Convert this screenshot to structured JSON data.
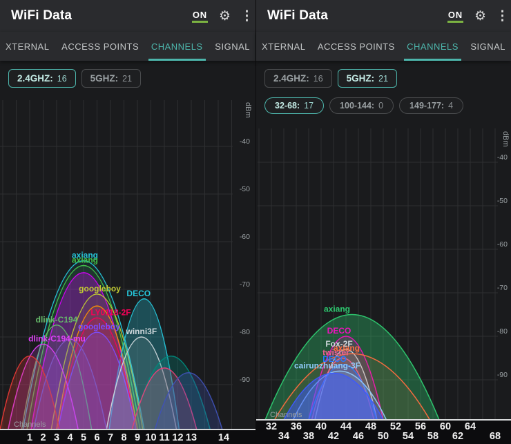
{
  "app": {
    "title": "WiFi Data",
    "on_toggle": "ON",
    "accent_color": "#4db6ac",
    "on_underline_color": "#7cb342",
    "icons": [
      "gear-icon",
      "more-options-icon"
    ]
  },
  "tabs": [
    {
      "label": "XTERNAL",
      "selected": false
    },
    {
      "label": "ACCESS POINTS",
      "selected": false
    },
    {
      "label": "CHANNELS",
      "selected": true
    },
    {
      "label": "SIGNAL",
      "selected": false
    }
  ],
  "panels": [
    {
      "name": "2.4ghz",
      "band_chips": [
        {
          "label": "2.4GHZ:",
          "count": "16",
          "selected": true
        },
        {
          "label": "5GHZ:",
          "count": "21",
          "selected": false
        }
      ],
      "range_chips": [],
      "chart": {
        "y_axis": {
          "unit": "dBm",
          "ticks": [
            "-40",
            "-50",
            "-60",
            "-70",
            "-80",
            "-90"
          ]
        },
        "x_axis": {
          "label": "Channels",
          "rows": [
            [
              "1",
              "2",
              "3",
              "4",
              "5",
              "6",
              "7",
              "8",
              "9",
              "10",
              "11",
              "12",
              "13",
              "14"
            ]
          ]
        },
        "networks": [
          {
            "ssid": "axiang",
            "channel": 5,
            "dbm": -64,
            "width_channels": 4.5,
            "color": "#26c6da",
            "fill_opacity": 0.08,
            "label_dx": 2
          },
          {
            "ssid": "axiang",
            "channel": 5,
            "dbm": -65,
            "width_channels": 4.2,
            "color": "#43c54b",
            "fill_opacity": 0.1,
            "label_dx": 2
          },
          {
            "ssid": "",
            "channel": 5,
            "dbm": -66.5,
            "width_channels": 3.9,
            "color": "#d500f9",
            "fill_opacity": 0.3,
            "label_dx": 0
          },
          {
            "ssid": "googleboy",
            "channel": 6,
            "dbm": -71,
            "width_channels": 3.4,
            "color": "#c0ca33",
            "fill_opacity": 0.08,
            "label_dx": 4
          },
          {
            "ssid": "",
            "channel": 6,
            "dbm": -73.5,
            "width_channels": 3.0,
            "color": "#ff9100",
            "fill_opacity": 0.1,
            "label_dx": 0
          },
          {
            "ssid": "DECO",
            "channel": 9.5,
            "dbm": -72,
            "width_channels": 2.6,
            "color": "#26c6da",
            "fill_opacity": 0.3,
            "label_dx": -8
          },
          {
            "ssid": "LY0118-2F",
            "channel": 6,
            "dbm": -76,
            "width_channels": 2.9,
            "color": "#f50057",
            "fill_opacity": 0.18,
            "label_dx": 20
          },
          {
            "ssid": "dlink-C194",
            "channel": 3,
            "dbm": -77.5,
            "width_channels": 2.6,
            "color": "#66bb6a",
            "fill_opacity": 0.1,
            "label_dx": 0
          },
          {
            "ssid": "googleboy",
            "channel": 6,
            "dbm": -79,
            "width_channels": 2.9,
            "color": "#7c4dff",
            "fill_opacity": 0.22,
            "label_dx": 3
          },
          {
            "ssid": "winni3F",
            "channel": 9.3,
            "dbm": -80,
            "width_channels": 2.6,
            "color": "#cfd8dc",
            "fill_opacity": 0.1,
            "label_dx": 0
          },
          {
            "ssid": "dlink-C194-mu",
            "channel": 2,
            "dbm": -81.5,
            "width_channels": 2.6,
            "color": "#e040fb",
            "fill_opacity": 0.18,
            "label_dx": 20
          },
          {
            "ssid": "",
            "channel": 1,
            "dbm": -84,
            "width_channels": 2.2,
            "color": "#e53935",
            "fill_opacity": 0.25,
            "label_dx": 0
          },
          {
            "ssid": "",
            "channel": 4,
            "dbm": -80.5,
            "width_channels": 2.7,
            "color": "#7e57c2",
            "fill_opacity": 0.22,
            "label_dx": 0
          },
          {
            "ssid": "",
            "channel": 11.5,
            "dbm": -84,
            "width_channels": 2.9,
            "color": "#00897b",
            "fill_opacity": 0.3,
            "label_dx": 0
          },
          {
            "ssid": "",
            "channel": 11,
            "dbm": -86.5,
            "width_channels": 2.4,
            "color": "#ec407a",
            "fill_opacity": 0.22,
            "label_dx": 0
          },
          {
            "ssid": "",
            "channel": 12.8,
            "dbm": -87.5,
            "width_channels": 2.5,
            "color": "#3f51b5",
            "fill_opacity": 0.28,
            "label_dx": 0
          }
        ]
      }
    },
    {
      "name": "5ghz",
      "band_chips": [
        {
          "label": "2.4GHZ:",
          "count": "16",
          "selected": false
        },
        {
          "label": "5GHZ:",
          "count": "21",
          "selected": true
        }
      ],
      "range_chips": [
        {
          "label": "32-68:",
          "count": "17",
          "selected": true
        },
        {
          "label": "100-144:",
          "count": "0",
          "selected": false
        },
        {
          "label": "149-177:",
          "count": "4",
          "selected": false
        }
      ],
      "chart": {
        "y_axis": {
          "unit": "dBm",
          "ticks": [
            "-40",
            "-50",
            "-60",
            "-70",
            "-80",
            "-90"
          ]
        },
        "x_axis": {
          "label": "Channels",
          "rows": [
            [
              "32",
              "36",
              "40",
              "44",
              "48",
              "52",
              "56",
              "60",
              "64"
            ],
            [
              "34",
              "38",
              "42",
              "46",
              "50",
              "54",
              "58",
              "62",
              "68"
            ]
          ]
        },
        "networks": [
          {
            "ssid": "axiang",
            "channel": 45,
            "dbm": -75,
            "width_channels": 14,
            "color": "#2ecc71",
            "fill_opacity": 0.34,
            "label_dx": -22
          },
          {
            "ssid": "DECO",
            "channel": 44,
            "dbm": -80,
            "width_channels": 6,
            "color": "#f012be",
            "fill_opacity": 0.18,
            "label_dx": -10
          },
          {
            "ssid": "Fox-2F",
            "channel": 44,
            "dbm": -83,
            "width_channels": 5,
            "color": "#cfd8dc",
            "fill_opacity": 0.12,
            "label_dx": -10
          },
          {
            "ssid": "axiang",
            "channel": 45,
            "dbm": -84,
            "width_channels": 12.5,
            "color": "#ff6d3f",
            "fill_opacity": 0.1,
            "label_dx": -8
          },
          {
            "ssid": "twister",
            "channel": 43.5,
            "dbm": -85,
            "width_channels": 5,
            "color": "#f06292",
            "fill_opacity": 0.12,
            "label_dx": -10
          },
          {
            "ssid": "DECO",
            "channel": 43.5,
            "dbm": -86.5,
            "width_channels": 5.5,
            "color": "#2979ff",
            "fill_opacity": 0.25,
            "label_dx": -12
          },
          {
            "ssid": "cairunzhuang-3F",
            "channel": 43,
            "dbm": -88,
            "width_channels": 7.5,
            "color": "#90caf9",
            "fill_opacity": 0.15,
            "label_dx": -18
          },
          {
            "ssid": "",
            "channel": 42,
            "dbm": -88.5,
            "width_channels": 8,
            "color": "#3d5afe",
            "fill_opacity": 0.5,
            "label_dx": 0
          }
        ]
      }
    }
  ]
}
